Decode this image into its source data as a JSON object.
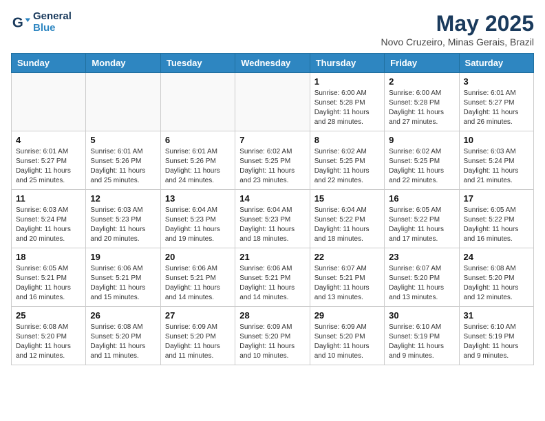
{
  "logo": {
    "line1": "General",
    "line2": "Blue"
  },
  "title": "May 2025",
  "location": "Novo Cruzeiro, Minas Gerais, Brazil",
  "weekdays": [
    "Sunday",
    "Monday",
    "Tuesday",
    "Wednesday",
    "Thursday",
    "Friday",
    "Saturday"
  ],
  "weeks": [
    [
      {
        "day": "",
        "info": ""
      },
      {
        "day": "",
        "info": ""
      },
      {
        "day": "",
        "info": ""
      },
      {
        "day": "",
        "info": ""
      },
      {
        "day": "1",
        "info": "Sunrise: 6:00 AM\nSunset: 5:28 PM\nDaylight: 11 hours and 28 minutes."
      },
      {
        "day": "2",
        "info": "Sunrise: 6:00 AM\nSunset: 5:28 PM\nDaylight: 11 hours and 27 minutes."
      },
      {
        "day": "3",
        "info": "Sunrise: 6:01 AM\nSunset: 5:27 PM\nDaylight: 11 hours and 26 minutes."
      }
    ],
    [
      {
        "day": "4",
        "info": "Sunrise: 6:01 AM\nSunset: 5:27 PM\nDaylight: 11 hours and 25 minutes."
      },
      {
        "day": "5",
        "info": "Sunrise: 6:01 AM\nSunset: 5:26 PM\nDaylight: 11 hours and 25 minutes."
      },
      {
        "day": "6",
        "info": "Sunrise: 6:01 AM\nSunset: 5:26 PM\nDaylight: 11 hours and 24 minutes."
      },
      {
        "day": "7",
        "info": "Sunrise: 6:02 AM\nSunset: 5:25 PM\nDaylight: 11 hours and 23 minutes."
      },
      {
        "day": "8",
        "info": "Sunrise: 6:02 AM\nSunset: 5:25 PM\nDaylight: 11 hours and 22 minutes."
      },
      {
        "day": "9",
        "info": "Sunrise: 6:02 AM\nSunset: 5:25 PM\nDaylight: 11 hours and 22 minutes."
      },
      {
        "day": "10",
        "info": "Sunrise: 6:03 AM\nSunset: 5:24 PM\nDaylight: 11 hours and 21 minutes."
      }
    ],
    [
      {
        "day": "11",
        "info": "Sunrise: 6:03 AM\nSunset: 5:24 PM\nDaylight: 11 hours and 20 minutes."
      },
      {
        "day": "12",
        "info": "Sunrise: 6:03 AM\nSunset: 5:23 PM\nDaylight: 11 hours and 20 minutes."
      },
      {
        "day": "13",
        "info": "Sunrise: 6:04 AM\nSunset: 5:23 PM\nDaylight: 11 hours and 19 minutes."
      },
      {
        "day": "14",
        "info": "Sunrise: 6:04 AM\nSunset: 5:23 PM\nDaylight: 11 hours and 18 minutes."
      },
      {
        "day": "15",
        "info": "Sunrise: 6:04 AM\nSunset: 5:22 PM\nDaylight: 11 hours and 18 minutes."
      },
      {
        "day": "16",
        "info": "Sunrise: 6:05 AM\nSunset: 5:22 PM\nDaylight: 11 hours and 17 minutes."
      },
      {
        "day": "17",
        "info": "Sunrise: 6:05 AM\nSunset: 5:22 PM\nDaylight: 11 hours and 16 minutes."
      }
    ],
    [
      {
        "day": "18",
        "info": "Sunrise: 6:05 AM\nSunset: 5:21 PM\nDaylight: 11 hours and 16 minutes."
      },
      {
        "day": "19",
        "info": "Sunrise: 6:06 AM\nSunset: 5:21 PM\nDaylight: 11 hours and 15 minutes."
      },
      {
        "day": "20",
        "info": "Sunrise: 6:06 AM\nSunset: 5:21 PM\nDaylight: 11 hours and 14 minutes."
      },
      {
        "day": "21",
        "info": "Sunrise: 6:06 AM\nSunset: 5:21 PM\nDaylight: 11 hours and 14 minutes."
      },
      {
        "day": "22",
        "info": "Sunrise: 6:07 AM\nSunset: 5:21 PM\nDaylight: 11 hours and 13 minutes."
      },
      {
        "day": "23",
        "info": "Sunrise: 6:07 AM\nSunset: 5:20 PM\nDaylight: 11 hours and 13 minutes."
      },
      {
        "day": "24",
        "info": "Sunrise: 6:08 AM\nSunset: 5:20 PM\nDaylight: 11 hours and 12 minutes."
      }
    ],
    [
      {
        "day": "25",
        "info": "Sunrise: 6:08 AM\nSunset: 5:20 PM\nDaylight: 11 hours and 12 minutes."
      },
      {
        "day": "26",
        "info": "Sunrise: 6:08 AM\nSunset: 5:20 PM\nDaylight: 11 hours and 11 minutes."
      },
      {
        "day": "27",
        "info": "Sunrise: 6:09 AM\nSunset: 5:20 PM\nDaylight: 11 hours and 11 minutes."
      },
      {
        "day": "28",
        "info": "Sunrise: 6:09 AM\nSunset: 5:20 PM\nDaylight: 11 hours and 10 minutes."
      },
      {
        "day": "29",
        "info": "Sunrise: 6:09 AM\nSunset: 5:20 PM\nDaylight: 11 hours and 10 minutes."
      },
      {
        "day": "30",
        "info": "Sunrise: 6:10 AM\nSunset: 5:19 PM\nDaylight: 11 hours and 9 minutes."
      },
      {
        "day": "31",
        "info": "Sunrise: 6:10 AM\nSunset: 5:19 PM\nDaylight: 11 hours and 9 minutes."
      }
    ]
  ]
}
